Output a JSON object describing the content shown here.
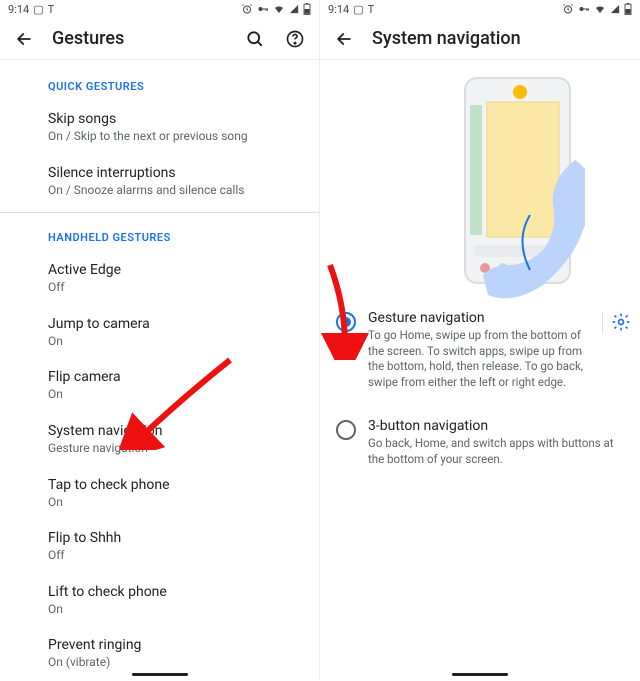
{
  "status": {
    "time": "9:14"
  },
  "left": {
    "title": "Gestures",
    "sections": {
      "quick": {
        "header": "QUICK GESTURES",
        "items": [
          {
            "title": "Skip songs",
            "sub": "On / Skip to the next or previous song"
          },
          {
            "title": "Silence interruptions",
            "sub": "On / Snooze alarms and silence calls"
          }
        ]
      },
      "handheld": {
        "header": "HANDHELD GESTURES",
        "items": [
          {
            "title": "Active Edge",
            "sub": "Off"
          },
          {
            "title": "Jump to camera",
            "sub": "On"
          },
          {
            "title": "Flip camera",
            "sub": "On"
          },
          {
            "title": "System navigation",
            "sub": "Gesture navigation"
          },
          {
            "title": "Tap to check phone",
            "sub": "On"
          },
          {
            "title": "Flip to Shhh",
            "sub": "Off"
          },
          {
            "title": "Lift to check phone",
            "sub": "On"
          },
          {
            "title": "Prevent ringing",
            "sub": "On (vibrate)"
          }
        ]
      }
    }
  },
  "right": {
    "title": "System navigation",
    "options": [
      {
        "title": "Gesture navigation",
        "desc": "To go Home, swipe up from the bottom of the screen. To switch apps, swipe up from the bottom, hold, then release. To go back, swipe from either the left or right edge.",
        "selected": true,
        "has_settings": true
      },
      {
        "title": "3-button navigation",
        "desc": "Go back, Home, and switch apps with buttons at the bottom of your screen.",
        "selected": false,
        "has_settings": false
      }
    ]
  }
}
